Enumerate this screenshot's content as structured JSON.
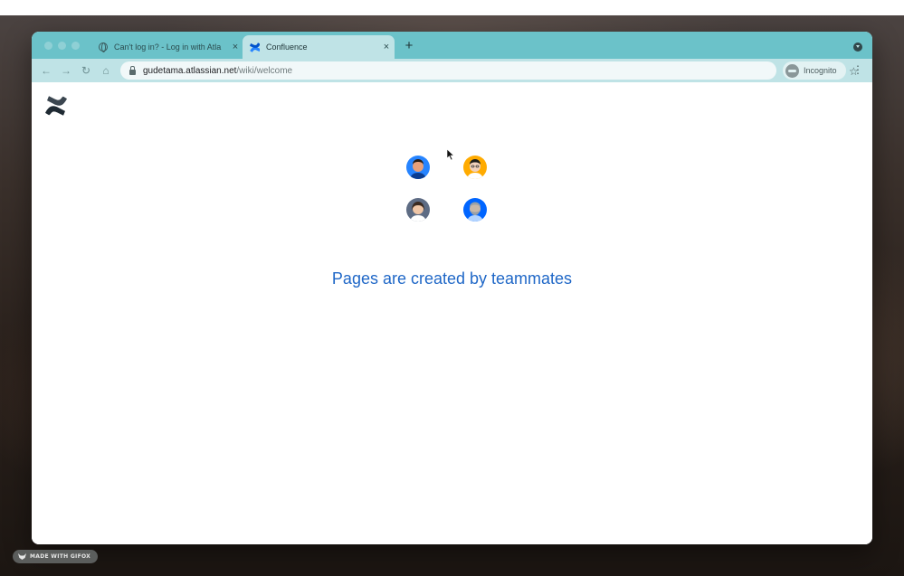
{
  "browser": {
    "tabs": [
      {
        "title": "Can't log in? - Log in with Atla",
        "close": "×",
        "active": false
      },
      {
        "title": "Confluence",
        "close": "×",
        "active": true
      }
    ],
    "new_tab": "+",
    "toolbar": {
      "back": "←",
      "forward": "→",
      "reload": "↻",
      "home": "⌂",
      "bookmark": "☆",
      "menu": "⋮"
    },
    "url": {
      "host": "gudetama.atlassian.net",
      "path": "/wiki/welcome"
    },
    "incognito_label": "Incognito"
  },
  "page": {
    "headline": "Pages are created by teammates",
    "avatars": [
      {
        "name": "teammate-1",
        "bg": "#2684ff"
      },
      {
        "name": "teammate-2",
        "bg": "#ffab00"
      },
      {
        "name": "teammate-3",
        "bg": "#5e6c84"
      },
      {
        "name": "teammate-4",
        "bg": "#0065ff"
      }
    ]
  },
  "colors": {
    "brand_blue": "#1f67c7",
    "tab_strip": "#6bc2c9",
    "toolbar": "#bfe3e6"
  },
  "badge": {
    "text": "MADE WITH GIFOX"
  }
}
